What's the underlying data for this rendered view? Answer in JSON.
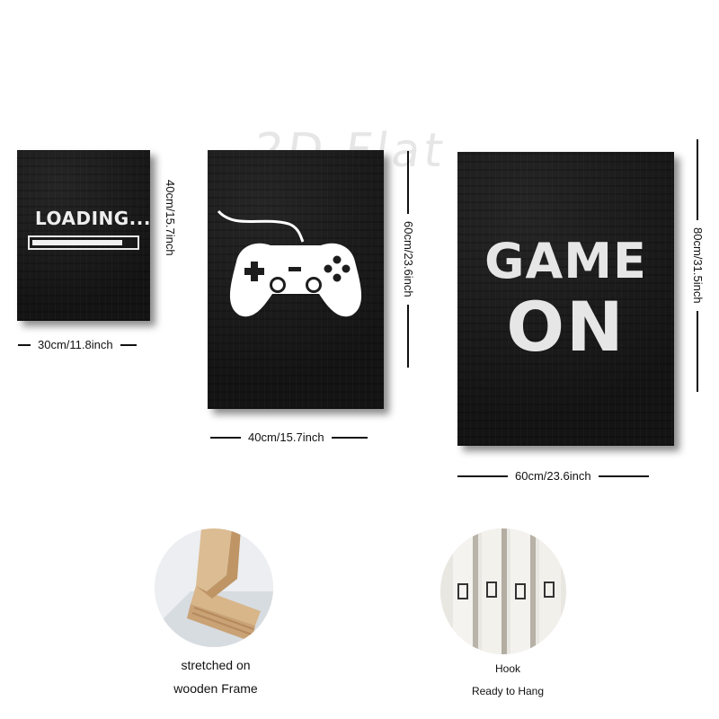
{
  "watermark": "2D Flat",
  "panels": {
    "small": {
      "loading_text": "LOADING...",
      "progress_fraction": 0.88,
      "width_label": "30cm/11.8inch",
      "height_label": "40cm/15.7inch"
    },
    "medium": {
      "icon": "gamepad-icon",
      "width_label": "40cm/15.7inch",
      "height_label": "60cm/23.6inch"
    },
    "large": {
      "line1": "GAME",
      "line2": "ON",
      "width_label": "60cm/23.6inch",
      "height_label": "80cm/31.5inch"
    }
  },
  "features": {
    "frame": {
      "line1": "stretched on",
      "line2": "wooden Frame"
    },
    "hook": {
      "line1": "Hook",
      "line2": "Ready to Hang"
    }
  },
  "colors": {
    "panel_bg": "#1d1d1d",
    "print_white": "#ffffff",
    "wood": "#d9b98f"
  }
}
